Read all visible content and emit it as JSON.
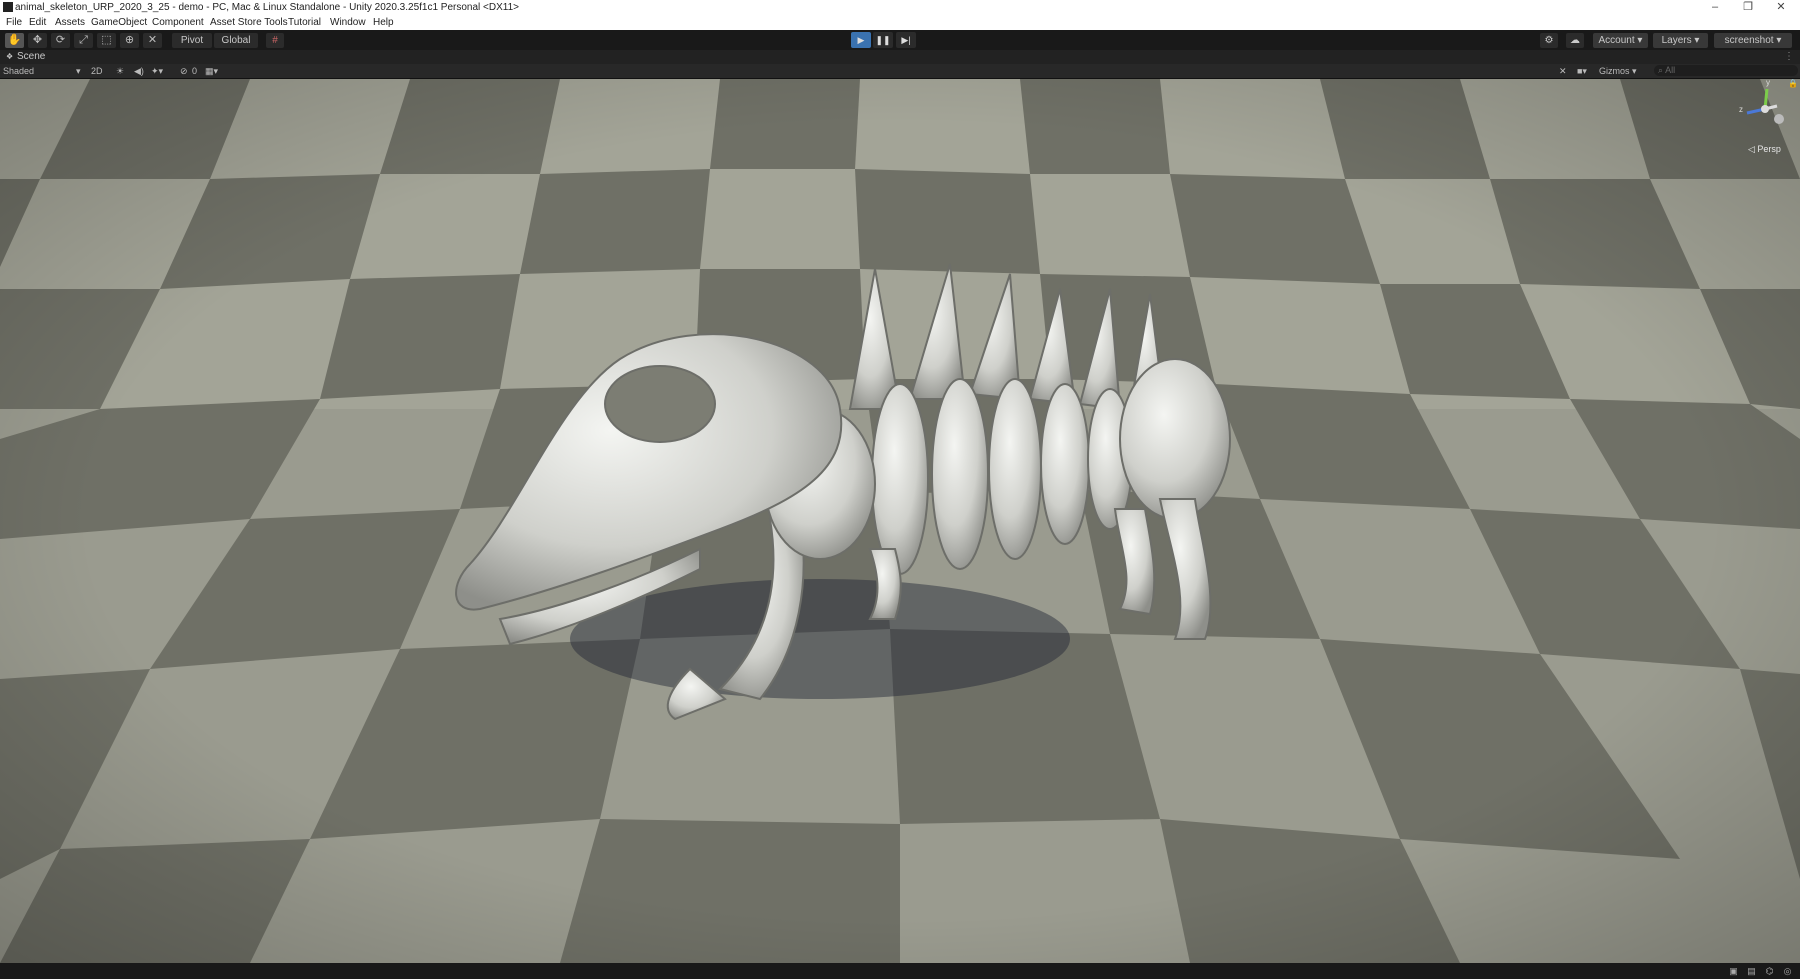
{
  "window": {
    "title": "animal_skeleton_URP_2020_3_25 - demo - PC, Mac & Linux Standalone - Unity 2020.3.25f1c1 Personal <DX11>",
    "controls": {
      "minimize": "–",
      "maximize": "❐",
      "close": "✕"
    }
  },
  "menu": {
    "items": [
      "File",
      "Edit",
      "Assets",
      "GameObject",
      "Component",
      "Asset Store Tools",
      "Tutorial",
      "Window",
      "Help"
    ]
  },
  "toolbar": {
    "tools": [
      {
        "name": "hand-tool-icon",
        "glyph": "✋"
      },
      {
        "name": "move-tool-icon",
        "glyph": "✥"
      },
      {
        "name": "rotate-tool-icon",
        "glyph": "⟳"
      },
      {
        "name": "scale-tool-icon",
        "glyph": "⤢"
      },
      {
        "name": "rect-tool-icon",
        "glyph": "⬚"
      },
      {
        "name": "transform-tool-icon",
        "glyph": "⊕"
      },
      {
        "name": "custom-tool-icon",
        "glyph": "✕"
      }
    ],
    "pivot_label": "Pivot",
    "global_label": "Global",
    "account_label": "Account",
    "layers_label": "Layers",
    "layout_label": "screenshot",
    "play_glyph": "▶",
    "pause_glyph": "❚❚",
    "step_glyph": "▶|",
    "accent": "#3a72b0"
  },
  "scene": {
    "tab_label": "Scene",
    "shading_mode": "Shaded",
    "mode_2d": "2D",
    "effects_count": "0",
    "gizmos_label": "Gizmos",
    "search_placeholder": "All",
    "projection_label": "Persp",
    "axis_y": "y",
    "axis_z": "z"
  },
  "colors": {
    "checker_light": "#9a9b8f",
    "checker_dark": "#6b6c62",
    "bone": "#d9dad6"
  }
}
